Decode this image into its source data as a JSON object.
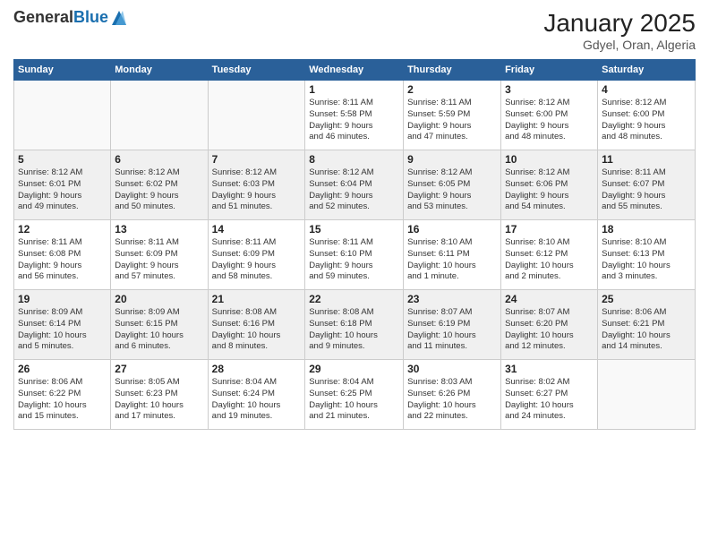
{
  "logo": {
    "general": "General",
    "blue": "Blue"
  },
  "header": {
    "title": "January 2025",
    "location": "Gdyel, Oran, Algeria"
  },
  "days_of_week": [
    "Sunday",
    "Monday",
    "Tuesday",
    "Wednesday",
    "Thursday",
    "Friday",
    "Saturday"
  ],
  "weeks": [
    [
      {
        "day": "",
        "info": ""
      },
      {
        "day": "",
        "info": ""
      },
      {
        "day": "",
        "info": ""
      },
      {
        "day": "1",
        "info": "Sunrise: 8:11 AM\nSunset: 5:58 PM\nDaylight: 9 hours\nand 46 minutes."
      },
      {
        "day": "2",
        "info": "Sunrise: 8:11 AM\nSunset: 5:59 PM\nDaylight: 9 hours\nand 47 minutes."
      },
      {
        "day": "3",
        "info": "Sunrise: 8:12 AM\nSunset: 6:00 PM\nDaylight: 9 hours\nand 48 minutes."
      },
      {
        "day": "4",
        "info": "Sunrise: 8:12 AM\nSunset: 6:00 PM\nDaylight: 9 hours\nand 48 minutes."
      }
    ],
    [
      {
        "day": "5",
        "info": "Sunrise: 8:12 AM\nSunset: 6:01 PM\nDaylight: 9 hours\nand 49 minutes."
      },
      {
        "day": "6",
        "info": "Sunrise: 8:12 AM\nSunset: 6:02 PM\nDaylight: 9 hours\nand 50 minutes."
      },
      {
        "day": "7",
        "info": "Sunrise: 8:12 AM\nSunset: 6:03 PM\nDaylight: 9 hours\nand 51 minutes."
      },
      {
        "day": "8",
        "info": "Sunrise: 8:12 AM\nSunset: 6:04 PM\nDaylight: 9 hours\nand 52 minutes."
      },
      {
        "day": "9",
        "info": "Sunrise: 8:12 AM\nSunset: 6:05 PM\nDaylight: 9 hours\nand 53 minutes."
      },
      {
        "day": "10",
        "info": "Sunrise: 8:12 AM\nSunset: 6:06 PM\nDaylight: 9 hours\nand 54 minutes."
      },
      {
        "day": "11",
        "info": "Sunrise: 8:11 AM\nSunset: 6:07 PM\nDaylight: 9 hours\nand 55 minutes."
      }
    ],
    [
      {
        "day": "12",
        "info": "Sunrise: 8:11 AM\nSunset: 6:08 PM\nDaylight: 9 hours\nand 56 minutes."
      },
      {
        "day": "13",
        "info": "Sunrise: 8:11 AM\nSunset: 6:09 PM\nDaylight: 9 hours\nand 57 minutes."
      },
      {
        "day": "14",
        "info": "Sunrise: 8:11 AM\nSunset: 6:09 PM\nDaylight: 9 hours\nand 58 minutes."
      },
      {
        "day": "15",
        "info": "Sunrise: 8:11 AM\nSunset: 6:10 PM\nDaylight: 9 hours\nand 59 minutes."
      },
      {
        "day": "16",
        "info": "Sunrise: 8:10 AM\nSunset: 6:11 PM\nDaylight: 10 hours\nand 1 minute."
      },
      {
        "day": "17",
        "info": "Sunrise: 8:10 AM\nSunset: 6:12 PM\nDaylight: 10 hours\nand 2 minutes."
      },
      {
        "day": "18",
        "info": "Sunrise: 8:10 AM\nSunset: 6:13 PM\nDaylight: 10 hours\nand 3 minutes."
      }
    ],
    [
      {
        "day": "19",
        "info": "Sunrise: 8:09 AM\nSunset: 6:14 PM\nDaylight: 10 hours\nand 5 minutes."
      },
      {
        "day": "20",
        "info": "Sunrise: 8:09 AM\nSunset: 6:15 PM\nDaylight: 10 hours\nand 6 minutes."
      },
      {
        "day": "21",
        "info": "Sunrise: 8:08 AM\nSunset: 6:16 PM\nDaylight: 10 hours\nand 8 minutes."
      },
      {
        "day": "22",
        "info": "Sunrise: 8:08 AM\nSunset: 6:18 PM\nDaylight: 10 hours\nand 9 minutes."
      },
      {
        "day": "23",
        "info": "Sunrise: 8:07 AM\nSunset: 6:19 PM\nDaylight: 10 hours\nand 11 minutes."
      },
      {
        "day": "24",
        "info": "Sunrise: 8:07 AM\nSunset: 6:20 PM\nDaylight: 10 hours\nand 12 minutes."
      },
      {
        "day": "25",
        "info": "Sunrise: 8:06 AM\nSunset: 6:21 PM\nDaylight: 10 hours\nand 14 minutes."
      }
    ],
    [
      {
        "day": "26",
        "info": "Sunrise: 8:06 AM\nSunset: 6:22 PM\nDaylight: 10 hours\nand 15 minutes."
      },
      {
        "day": "27",
        "info": "Sunrise: 8:05 AM\nSunset: 6:23 PM\nDaylight: 10 hours\nand 17 minutes."
      },
      {
        "day": "28",
        "info": "Sunrise: 8:04 AM\nSunset: 6:24 PM\nDaylight: 10 hours\nand 19 minutes."
      },
      {
        "day": "29",
        "info": "Sunrise: 8:04 AM\nSunset: 6:25 PM\nDaylight: 10 hours\nand 21 minutes."
      },
      {
        "day": "30",
        "info": "Sunrise: 8:03 AM\nSunset: 6:26 PM\nDaylight: 10 hours\nand 22 minutes."
      },
      {
        "day": "31",
        "info": "Sunrise: 8:02 AM\nSunset: 6:27 PM\nDaylight: 10 hours\nand 24 minutes."
      },
      {
        "day": "",
        "info": ""
      }
    ]
  ]
}
